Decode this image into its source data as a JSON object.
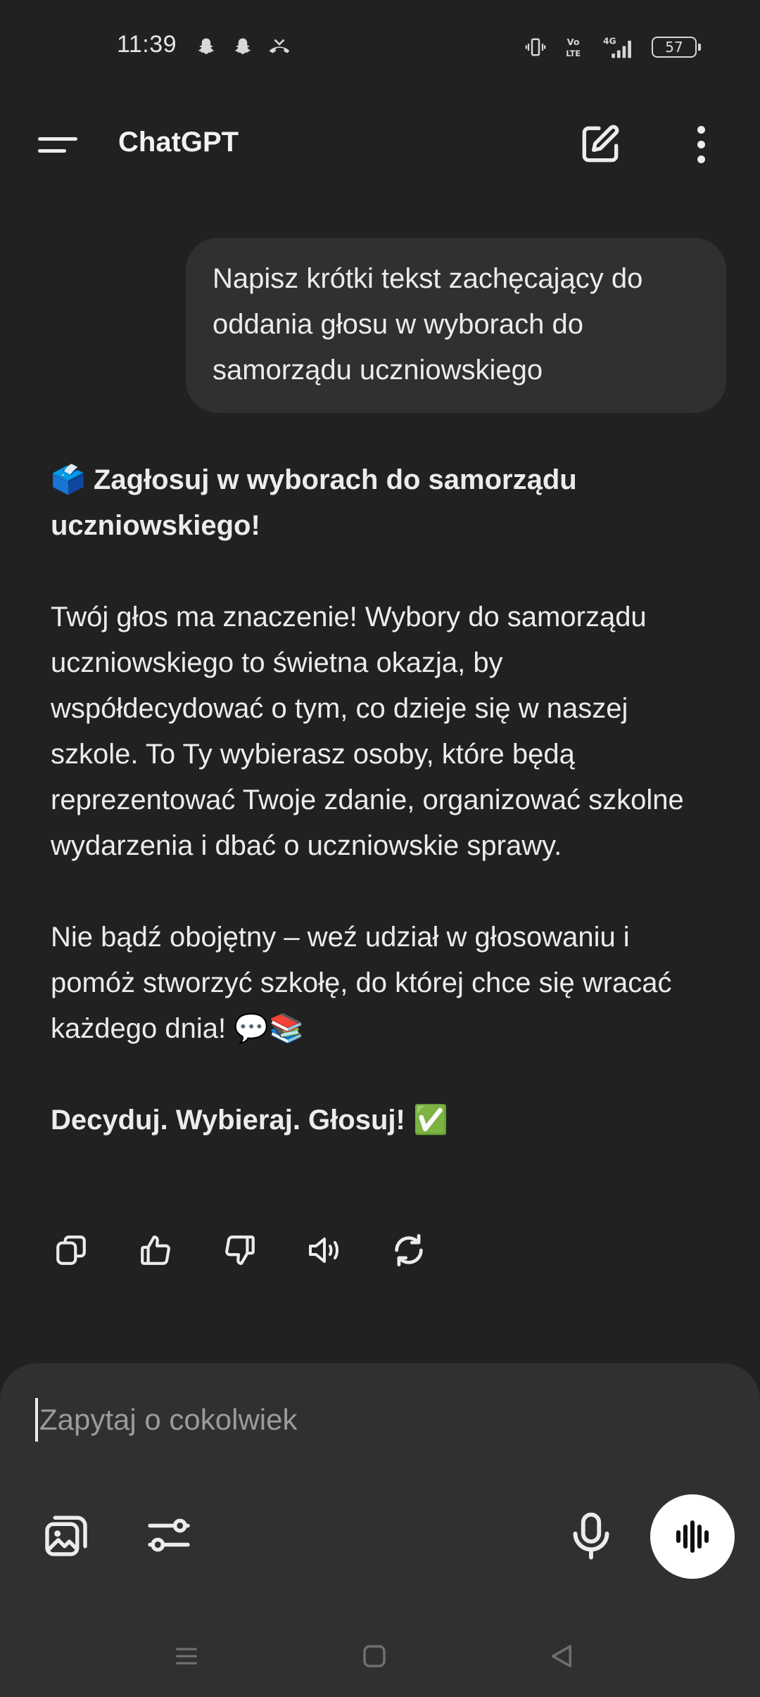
{
  "status_bar": {
    "time": "11:39",
    "battery": "57",
    "left_icons": [
      "snapchat-icon",
      "snapchat-icon",
      "missed-call-icon"
    ],
    "right_icons": [
      "vibrate-icon",
      "volte-icon",
      "signal-4g-icon",
      "battery-icon"
    ]
  },
  "app_bar": {
    "title": "ChatGPT"
  },
  "conversation": {
    "user_message": "Napisz krótki tekst zachęcający do oddania głosu w wyborach do samorządu uczniowskiego",
    "assistant": {
      "heading_emoji": "🗳️",
      "heading": "Zagłosuj w wyborach do samorządu uczniowskiego!",
      "paragraph1": "Twój głos ma znaczenie! Wybory do samorządu uczniowskiego to świetna okazja, by współdecydować o tym, co dzieje się w naszej szkole. To Ty wybierasz osoby, które będą reprezentować Twoje zdanie, organizować szkolne wydarzenia i dbać o uczniowskie sprawy.",
      "paragraph2": "Nie bądź obojętny – weź udział w głosowaniu i pomóż stworzyć szkołę, do której chce się wracać każdego dnia! 💬📚",
      "closing": "Decyduj. Wybieraj. Głosuj!",
      "closing_emoji": "✅"
    }
  },
  "composer": {
    "placeholder": "Zapytaj o cokolwiek"
  },
  "colors": {
    "background": "#212121",
    "bubble": "#303030",
    "composer": "#303030",
    "text": "#ececec",
    "placeholder": "#9b9b9b"
  }
}
